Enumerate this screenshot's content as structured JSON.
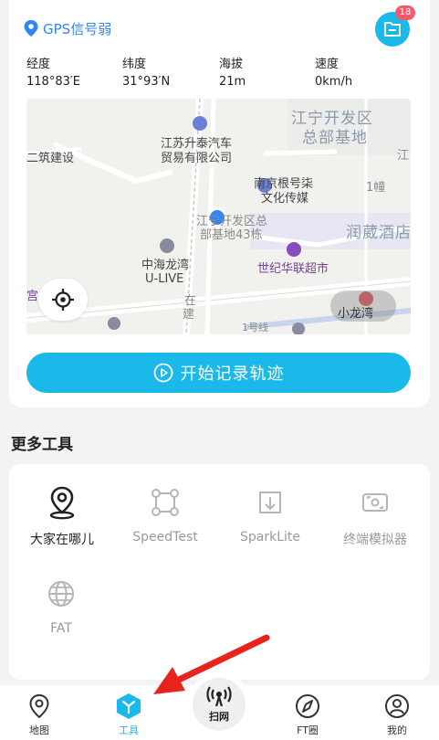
{
  "header": {
    "gps_status": "GPS信号弱",
    "folder_badge": "18"
  },
  "stats": [
    {
      "label": "经度",
      "value": "118°83′E"
    },
    {
      "label": "纬度",
      "value": "31°93′N"
    },
    {
      "label": "海拔",
      "value": "21m"
    },
    {
      "label": "速度",
      "value": "0km/h"
    }
  ],
  "map": {
    "labels": {
      "kaifaqu": "江宁开发区",
      "zongbu": "总部基地",
      "jiangsu_1": "江苏升泰汽车",
      "jiangsu_2": "贸易有限公司",
      "jianshe": "二筑建设",
      "nanjing_1": "南京根号柒",
      "nanjing_2": "文化传媒",
      "jiang_right": "江",
      "building": "1幢",
      "jiangning_1": "江宁开发区总",
      "jiangning_2": "部基地43栋",
      "runzang": "润葳酒店",
      "zhonghai_1": "中海龙湾",
      "zhonghai_2": "U-LIVE",
      "shiji": "世纪华联超市",
      "zai": "在",
      "jian": "建",
      "line1": "1号线",
      "xiaolongwan": "小龙湾",
      "gong": "宫"
    }
  },
  "record_button": "开始记录轨迹",
  "more_tools": {
    "title": "更多工具",
    "items": [
      {
        "name": "大家在哪儿",
        "icon": "location-pin-icon"
      },
      {
        "name": "SpeedTest",
        "icon": "speed-test-icon"
      },
      {
        "name": "SparkLite",
        "icon": "download-box-icon"
      },
      {
        "name": "终端模拟器",
        "icon": "terminal-sim-icon"
      },
      {
        "name": "FAT",
        "icon": "globe-icon"
      }
    ]
  },
  "tabbar": {
    "items": [
      {
        "label": "地图"
      },
      {
        "label": "工具"
      },
      {
        "label": "扫网"
      },
      {
        "label": "FT圈"
      },
      {
        "label": "我的"
      }
    ]
  },
  "colors": {
    "accent": "#1ab9ea",
    "gps_blue": "#2f86f6",
    "badge_red": "#f25b6b",
    "annotation_red": "#e8231c"
  }
}
